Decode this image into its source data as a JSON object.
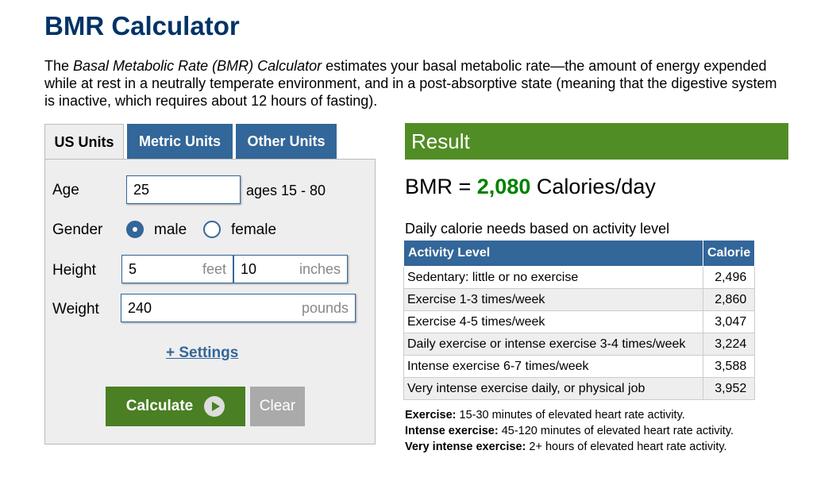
{
  "title": "BMR Calculator",
  "intro": {
    "before": "The ",
    "italic": "Basal Metabolic Rate (BMR) Calculator",
    "after": " estimates your basal metabolic rate—the amount of energy expended while at rest in a neutrally temperate environment, and in a post-absorptive state (meaning that the digestive system is inactive, which requires about 12 hours of fasting)."
  },
  "tabs": [
    {
      "label": "US Units",
      "active": true
    },
    {
      "label": "Metric Units",
      "active": false
    },
    {
      "label": "Other Units",
      "active": false
    }
  ],
  "form": {
    "age_label": "Age",
    "age_value": "25",
    "age_hint": "ages 15 - 80",
    "gender_label": "Gender",
    "gender_options": [
      "male",
      "female"
    ],
    "gender_selected": "male",
    "height_label": "Height",
    "height_feet": "5",
    "height_feet_unit": "feet",
    "height_inches": "10",
    "height_inches_unit": "inches",
    "weight_label": "Weight",
    "weight_value": "240",
    "weight_unit": "pounds",
    "settings_link": "+ Settings",
    "calculate_label": "Calculate",
    "clear_label": "Clear"
  },
  "result": {
    "header": "Result",
    "bmr_prefix": "BMR = ",
    "bmr_value": "2,080",
    "bmr_suffix": " Calories/day",
    "needs_label": "Daily calorie needs based on activity level",
    "table_headers": [
      "Activity Level",
      "Calorie"
    ],
    "rows": [
      [
        "Sedentary: little or no exercise",
        "2,496"
      ],
      [
        "Exercise 1-3 times/week",
        "2,860"
      ],
      [
        "Exercise 4-5 times/week",
        "3,047"
      ],
      [
        "Daily exercise or intense exercise 3-4 times/week",
        "3,224"
      ],
      [
        "Intense exercise 6-7 times/week",
        "3,588"
      ],
      [
        "Very intense exercise daily, or physical job",
        "3,952"
      ]
    ],
    "notes": [
      {
        "term": "Exercise:",
        "text": " 15-30 minutes of elevated heart rate activity."
      },
      {
        "term": "Intense exercise:",
        "text": " 45-120 minutes of elevated heart rate activity."
      },
      {
        "term": "Very intense exercise:",
        "text": " 2+ hours of elevated heart rate activity."
      }
    ]
  },
  "colors": {
    "title": "#003366",
    "tab": "#336699",
    "result_header": "#518d25",
    "calculate_button": "#4a7f24",
    "bmr_value": "#008000"
  }
}
